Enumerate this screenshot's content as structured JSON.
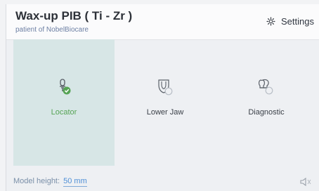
{
  "header": {
    "title": "Wax-up PIB ( Ti - Zr )",
    "subtitle": "patient of NobelBiocare",
    "settings_label": "Settings",
    "settings_icon": "gear-icon"
  },
  "tiles": [
    {
      "label": "Locator",
      "icon": "locator-icon",
      "selected": true,
      "status": "check"
    },
    {
      "label": "Lower Jaw",
      "icon": "lower-jaw-icon",
      "selected": false,
      "status": "pending"
    },
    {
      "label": "Diagnostic",
      "icon": "diagnostic-icon",
      "selected": false,
      "status": "pending"
    }
  ],
  "footer": {
    "model_height_label": "Model height:",
    "model_height_value": "50 mm",
    "speaker_icon": "speaker-icon"
  },
  "colors": {
    "selected_bg": "#d7e6e6",
    "accent_green": "#56a455",
    "link_blue": "#4f8fd6"
  }
}
